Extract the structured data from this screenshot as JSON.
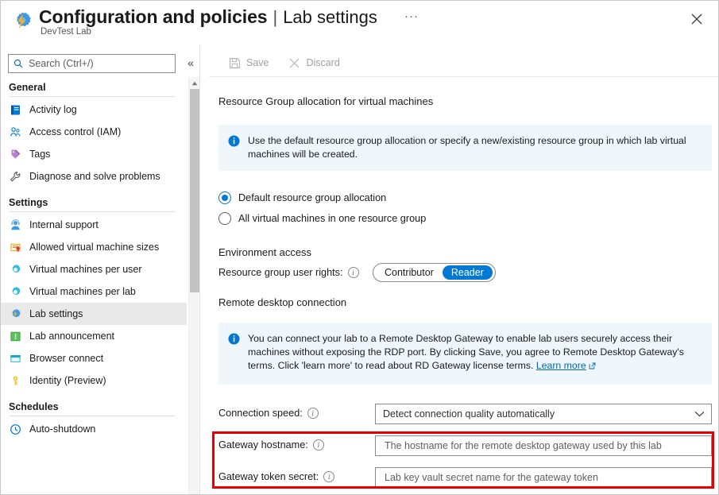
{
  "header": {
    "app_icon": "devtest-lab-gear-bolt-icon",
    "title_main": "Configuration and policies",
    "title_separator": "|",
    "title_page": "Lab settings",
    "subtitle": "DevTest Lab",
    "more_label": "···",
    "close_label": "Close"
  },
  "search": {
    "placeholder": "Search (Ctrl+/)",
    "value": "",
    "icon": "search-icon",
    "collapse_label": "«"
  },
  "toolbar": {
    "save_label": "Save",
    "save_icon": "save-disk-icon",
    "discard_label": "Discard",
    "discard_icon": "close-x-icon",
    "disabled_color": "#a19f9d"
  },
  "sidebar": {
    "groups": [
      {
        "label": "General",
        "items": [
          {
            "label": "Activity log",
            "icon": "activity-log-icon",
            "selected": false
          },
          {
            "label": "Access control (IAM)",
            "icon": "access-control-people-icon",
            "selected": false
          },
          {
            "label": "Tags",
            "icon": "tags-icon",
            "selected": false
          },
          {
            "label": "Diagnose and solve problems",
            "icon": "wrench-icon",
            "selected": false
          }
        ]
      },
      {
        "label": "Settings",
        "items": [
          {
            "label": "Internal support",
            "icon": "internal-support-person-icon",
            "selected": false
          },
          {
            "label": "Allowed virtual machine sizes",
            "icon": "certificate-icon",
            "selected": false
          },
          {
            "label": "Virtual machines per user",
            "icon": "gear-icon",
            "selected": false
          },
          {
            "label": "Virtual machines per lab",
            "icon": "gear-icon",
            "selected": false
          },
          {
            "label": "Lab settings",
            "icon": "gear-bolt-icon",
            "selected": true
          },
          {
            "label": "Lab announcement",
            "icon": "announcement-icon",
            "selected": false
          },
          {
            "label": "Browser connect",
            "icon": "browser-window-icon",
            "selected": false
          },
          {
            "label": "Identity (Preview)",
            "icon": "key-icon",
            "selected": false
          }
        ]
      },
      {
        "label": "Schedules",
        "items": [
          {
            "label": "Auto-shutdown",
            "icon": "clock-icon",
            "selected": false
          }
        ]
      }
    ]
  },
  "main": {
    "resource_group_section": {
      "title": "Resource Group allocation for virtual machines",
      "info_text": "Use the default resource group allocation or specify a new/existing resource group in which lab virtual machines will be created.",
      "info_icon": "info-circle-icon",
      "options": [
        {
          "label": "Default resource group allocation",
          "checked": true
        },
        {
          "label": "All virtual machines in one resource group",
          "checked": false
        }
      ]
    },
    "environment_access": {
      "title": "Environment access",
      "field_label": "Resource group user rights:",
      "info_icon": "info-tooltip-icon",
      "options": [
        "Contributor",
        "Reader"
      ],
      "selected": "Reader"
    },
    "remote_desktop": {
      "title": "Remote desktop connection",
      "info_text_part1": "You can connect your lab to a Remote Desktop Gateway to enable lab users securely access their machines without exposing the RDP port. By clicking Save, you agree to Remote Desktop Gateway's terms.  Click 'learn more' to read about RD Gateway license terms. ",
      "learn_more_label": "Learn more",
      "external_link_icon": "external-link-icon",
      "connection_speed": {
        "label": "Connection speed:",
        "value": "Detect connection quality automatically",
        "chevron_icon": "chevron-down-icon"
      },
      "gateway_hostname": {
        "label": "Gateway hostname:",
        "placeholder": "The hostname for the remote desktop gateway used by this lab",
        "value": ""
      },
      "gateway_token_secret": {
        "label": "Gateway token secret:",
        "placeholder": "Lab key vault secret name for the gateway token",
        "value": ""
      }
    },
    "highlight_color": "#e60000"
  }
}
